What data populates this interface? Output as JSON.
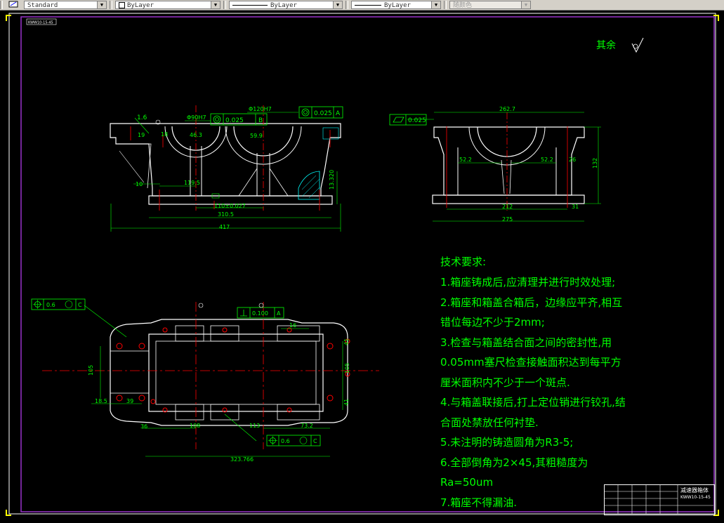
{
  "toolbar": {
    "text_style": "Standard",
    "layer": "ByLayer",
    "linetype": "ByLayer",
    "lineweight": "ByLayer",
    "color": "随颜色"
  },
  "drawing": {
    "corner_tag": "KWW10-15-45",
    "roughness_label": "其余",
    "front_view": {
      "dims": {
        "d1": "1.6",
        "d2": "Φ90H7",
        "d3": "Φ120H7",
        "d4": "46.3",
        "d5": "59.9",
        "d6": "18",
        "d7": "19",
        "d8": "10",
        "d9": "119.5",
        "d10": "110±0.027",
        "d11": "310.5",
        "d12": "417",
        "d13": "13.3",
        "d14": "20"
      },
      "tolerances": [
        {
          "flatness": "0.025",
          "datum": "B"
        },
        {
          "flatness": "0.025",
          "datum": "A"
        }
      ]
    },
    "side_view": {
      "dims": {
        "d1": "262.7",
        "d2": "52.2",
        "d3": "52.2",
        "d4": "26",
        "d5": "132",
        "d6": "212",
        "d7": "31",
        "d8": "275"
      },
      "tolerance": "0.025"
    },
    "plan_view": {
      "dims": {
        "d1": "105",
        "d2": "105",
        "d3": "18.5",
        "d4": "39",
        "d5": "36",
        "d6": "108",
        "d7": "113",
        "d8": "73.2",
        "d9": "323.766",
        "d10": "41",
        "d11": "41",
        "d12": "16"
      },
      "tolerances": {
        "pos_left": {
          "value": "0.6",
          "datum": "C"
        },
        "perp": {
          "value": "0.100",
          "datum": "A"
        },
        "pos_bottom": {
          "value": "0.6",
          "datum": "C"
        }
      }
    }
  },
  "tech_requirements": {
    "title": "技术要求:",
    "lines": [
      "1.箱座铸成后,应清理并进行时效处理;",
      "2.箱座和箱盖合箱后，边缘应平齐,相互",
      "错位每边不少于2mm;",
      "3.检查与箱盖结合面之间的密封性,用",
      "0.05mm塞尺检查接触面积达到每平方",
      "厘米面积内不少于一个斑点.",
      "4.与箱盖联接后,打上定位销进行铰孔,结",
      "合面处禁放任何衬垫.",
      "5.未注明的铸造圆角为R3-5;",
      "6.全部倒角为2×45,其粗糙度为",
      "Ra=50um",
      "7.箱座不得漏油."
    ]
  },
  "title_block": {
    "part_name": "减速器箱体",
    "drawing_no": "KWW10-15-45"
  },
  "colors": {
    "background": "#000000",
    "geometry": "#ffffff",
    "dimension": "#00ff00",
    "centerline": "#ff0000",
    "hatch": "#00ffff",
    "frame": "#8a2be2"
  }
}
